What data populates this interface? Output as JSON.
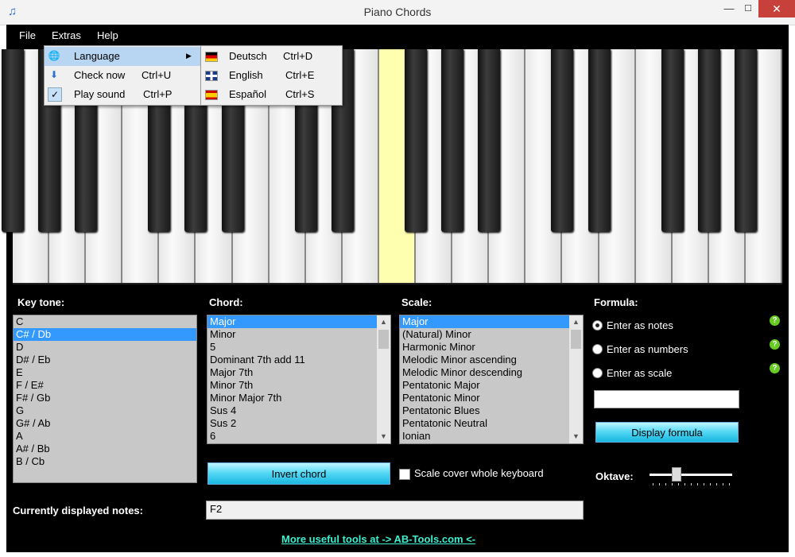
{
  "window": {
    "title": "Piano Chords",
    "app_icon": "music-note-icon"
  },
  "menubar": {
    "file": "File",
    "extras": "Extras",
    "help": "Help"
  },
  "extras_menu": {
    "language": "Language",
    "check_now": "Check now",
    "check_now_shortcut": "Ctrl+U",
    "play_sound": "Play sound",
    "play_sound_shortcut": "Ctrl+P",
    "play_sound_checked": true
  },
  "language_menu": [
    {
      "label": "Deutsch",
      "shortcut": "Ctrl+D",
      "flag": "flag-de-icon"
    },
    {
      "label": "English",
      "shortcut": "Ctrl+E",
      "flag": "flag-uk-icon"
    },
    {
      "label": "Español",
      "shortcut": "Ctrl+S",
      "flag": "flag-es-icon"
    }
  ],
  "piano": {
    "white_key_count": 21,
    "highlighted_white_key_index": 10,
    "highlight_color": "#ffffb0"
  },
  "key_tone": {
    "label": "Key tone:",
    "items": [
      "C",
      "C# / Db",
      "D",
      "D# / Eb",
      "E",
      "F / E#",
      "F# / Gb",
      "G",
      "G# / Ab",
      "A",
      "A# / Bb",
      "B / Cb"
    ],
    "selected": 1
  },
  "chord": {
    "label": "Chord:",
    "items": [
      "Major",
      "Minor",
      "5",
      "Dominant 7th add 11",
      "Major 7th",
      "Minor 7th",
      "Minor Major 7th",
      "Sus 4",
      "Sus 2",
      "6"
    ],
    "selected": 0
  },
  "scale": {
    "label": "Scale:",
    "items": [
      "Major",
      "(Natural) Minor",
      "Harmonic Minor",
      "Melodic Minor ascending",
      "Melodic Minor descending",
      "Pentatonic Major",
      "Pentatonic Minor",
      "Pentatonic Blues",
      "Pentatonic Neutral",
      "Ionian"
    ],
    "selected": 0
  },
  "formula": {
    "label": "Formula:",
    "options": [
      "Enter as notes",
      "Enter as numbers",
      "Enter as scale"
    ],
    "selected": 0,
    "input_value": "",
    "display_button": "Display formula"
  },
  "invert_button": "Invert chord",
  "scale_cover_label": "Scale cover whole keyboard",
  "scale_cover_checked": false,
  "octave": {
    "label": "Oktave:",
    "value": 1,
    "max": 6
  },
  "current_notes": {
    "label": "Currently displayed notes:",
    "value": "F2"
  },
  "footer_link": "More useful tools at -> AB-Tools.com <-",
  "colors": {
    "accent_link": "#3ef0d0",
    "selection": "#3399ff",
    "button": "#57d9f5"
  }
}
